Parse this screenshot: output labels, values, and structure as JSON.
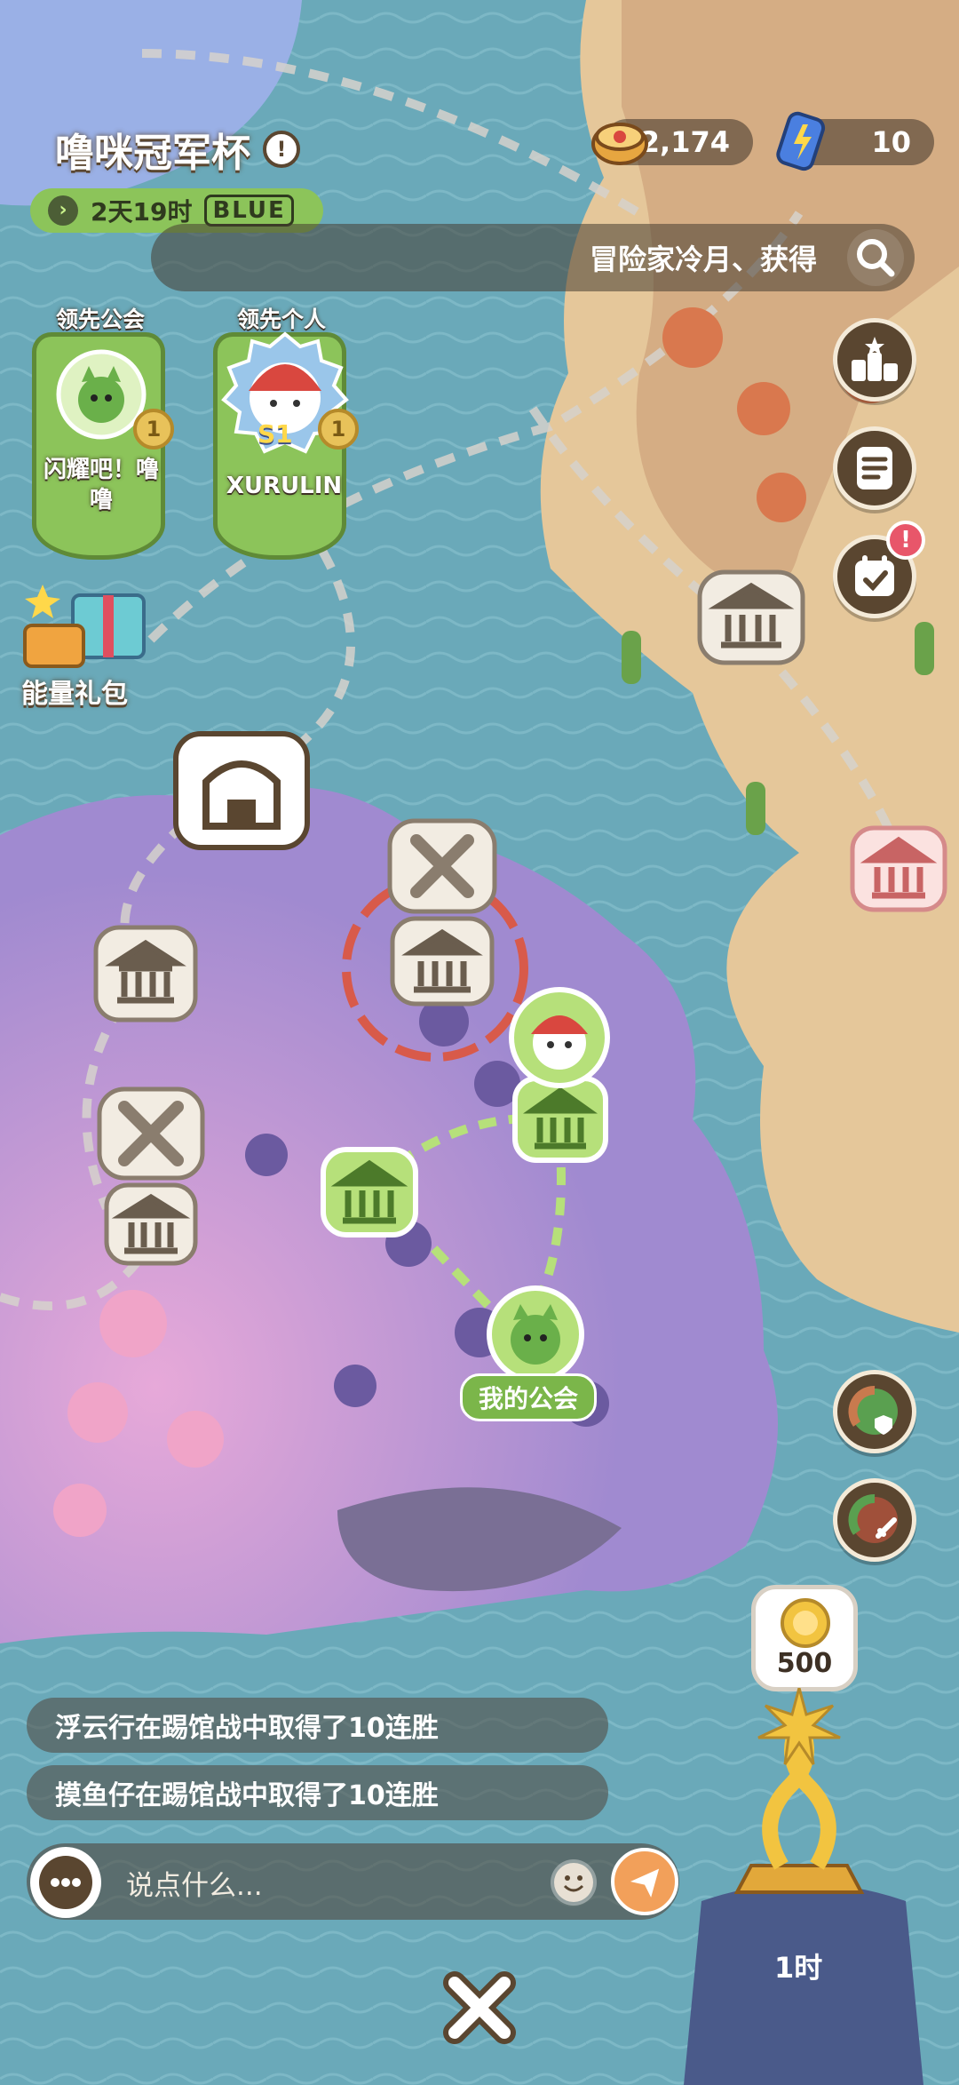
{
  "event": {
    "title": "噜咪冠军杯",
    "timer": "2天19时",
    "tier": "BLUE"
  },
  "resources": [
    {
      "icon": "canned-food-icon",
      "value": "2,174"
    },
    {
      "icon": "energy-drink-icon",
      "value": "10"
    }
  ],
  "search": {
    "ticker": "冒险家冷月、获得"
  },
  "leaders": [
    {
      "label": "领先公会",
      "name": "闪耀吧！噜噜",
      "rank": "1"
    },
    {
      "label": "领先个人",
      "name": "XURULIN",
      "rank": "1",
      "badge": "S1"
    }
  ],
  "gift": {
    "label": "能量礼包"
  },
  "map": {
    "my_guild_label": "我的公会"
  },
  "feed": [
    "浮云行在踢馆战中取得了10连胜",
    "摸鱼仔在踢馆战中取得了10连胜"
  ],
  "chat": {
    "placeholder": "说点什么..."
  },
  "reward": {
    "coins": "500",
    "time": "1时"
  },
  "colors": {
    "water": "#6aa9b9",
    "purple_island": "#a08ad0",
    "desert": "#e5c79a",
    "guild_green": "#8cc45a"
  }
}
